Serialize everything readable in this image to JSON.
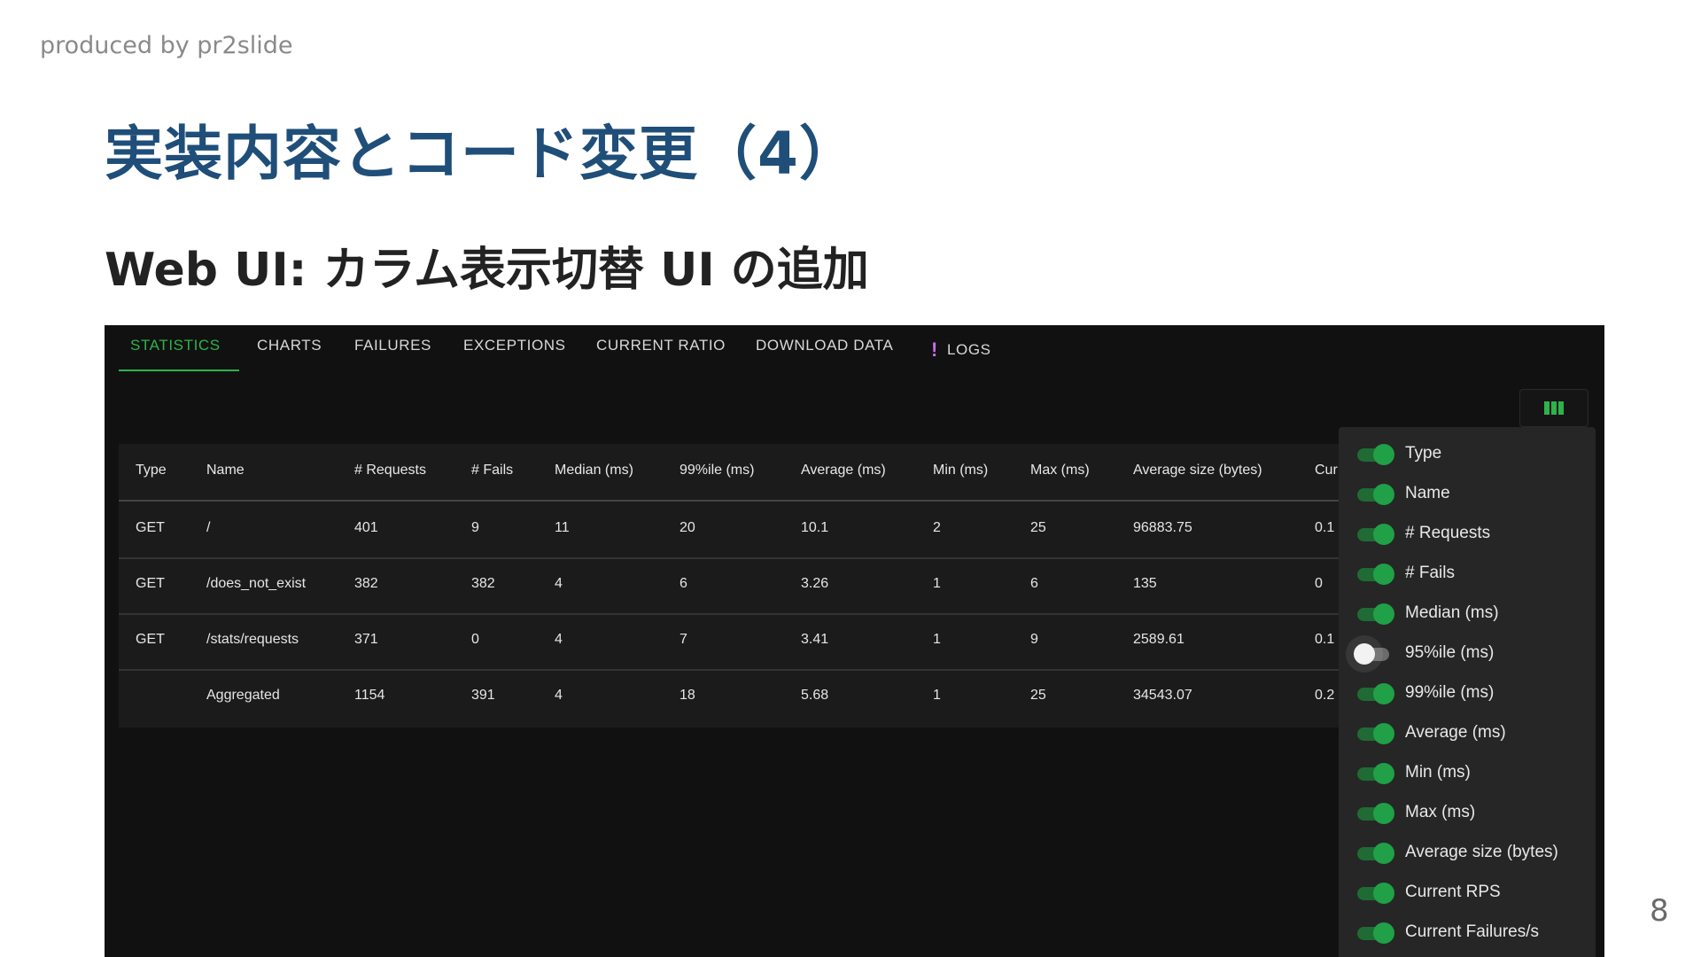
{
  "slide": {
    "producer": "produced by pr2slide",
    "title": "実装内容とコード変更（4）",
    "subtitle": "Web UI: カラム表示切替 UI の追加",
    "page_number": "8"
  },
  "tabs": [
    {
      "label": "STATISTICS",
      "active": true
    },
    {
      "label": "CHARTS"
    },
    {
      "label": "FAILURES"
    },
    {
      "label": "EXCEPTIONS"
    },
    {
      "label": "CURRENT RATIO"
    },
    {
      "label": "DOWNLOAD DATA"
    },
    {
      "label": "LOGS",
      "icon": "warning-exclamation-icon"
    }
  ],
  "column_button": {
    "icon": "columns-icon",
    "color": "#2db34a"
  },
  "table": {
    "headers": [
      "Type",
      "Name",
      "# Requests",
      "# Fails",
      "Median (ms)",
      "99%ile (ms)",
      "Average (ms)",
      "Min (ms)",
      "Max (ms)",
      "Average size (bytes)",
      "Cur"
    ],
    "rows": [
      [
        "GET",
        "/",
        "401",
        "9",
        "11",
        "20",
        "10.1",
        "2",
        "25",
        "96883.75",
        "0.1"
      ],
      [
        "GET",
        "/does_not_exist",
        "382",
        "382",
        "4",
        "6",
        "3.26",
        "1",
        "6",
        "135",
        "0"
      ],
      [
        "GET",
        "/stats/requests",
        "371",
        "0",
        "4",
        "7",
        "3.41",
        "1",
        "9",
        "2589.61",
        "0.1"
      ],
      [
        "",
        "Aggregated",
        "1154",
        "391",
        "4",
        "18",
        "5.68",
        "1",
        "25",
        "34543.07",
        "0.2"
      ]
    ]
  },
  "column_menu": [
    {
      "label": "Type",
      "on": true
    },
    {
      "label": "Name",
      "on": true
    },
    {
      "label": "# Requests",
      "on": true
    },
    {
      "label": "# Fails",
      "on": true
    },
    {
      "label": "Median (ms)",
      "on": true
    },
    {
      "label": "95%ile (ms)",
      "on": false
    },
    {
      "label": "99%ile (ms)",
      "on": true
    },
    {
      "label": "Average (ms)",
      "on": true
    },
    {
      "label": "Min (ms)",
      "on": true
    },
    {
      "label": "Max (ms)",
      "on": true
    },
    {
      "label": "Average size (bytes)",
      "on": true
    },
    {
      "label": "Current RPS",
      "on": true
    },
    {
      "label": "Current Failures/s",
      "on": true
    }
  ],
  "colors": {
    "accent": "#2db34a",
    "toggle_on": "#20a047",
    "toggle_off": "#f2f2f2",
    "title": "#1f4e79"
  }
}
